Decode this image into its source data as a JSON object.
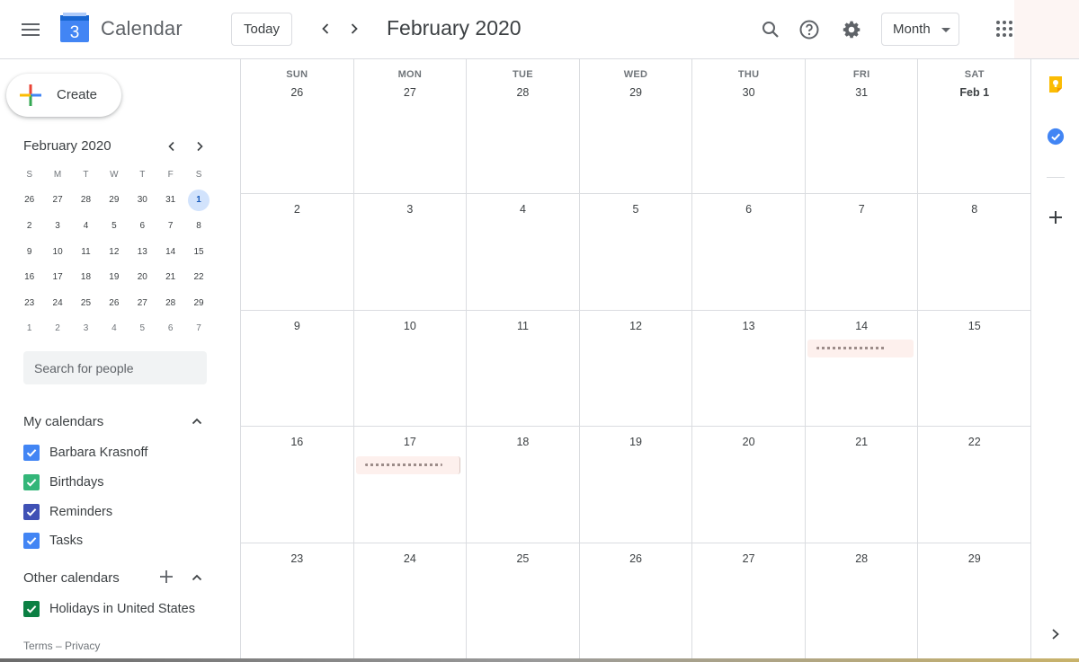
{
  "header": {
    "app_title": "Calendar",
    "logo_day": "3",
    "today_label": "Today",
    "current_period": "February 2020",
    "view_mode": "Month"
  },
  "sidebar": {
    "create_label": "Create",
    "mini_calendar": {
      "title": "February 2020",
      "weekday_initials": [
        "S",
        "M",
        "T",
        "W",
        "T",
        "F",
        "S"
      ],
      "weeks": [
        [
          "26",
          "27",
          "28",
          "29",
          "30",
          "31",
          "1"
        ],
        [
          "2",
          "3",
          "4",
          "5",
          "6",
          "7",
          "8"
        ],
        [
          "9",
          "10",
          "11",
          "12",
          "13",
          "14",
          "15"
        ],
        [
          "16",
          "17",
          "18",
          "19",
          "20",
          "21",
          "22"
        ],
        [
          "23",
          "24",
          "25",
          "26",
          "27",
          "28",
          "29"
        ],
        [
          "1",
          "2",
          "3",
          "4",
          "5",
          "6",
          "7"
        ]
      ],
      "selected_day": "1"
    },
    "search_placeholder": "Search for people",
    "my_calendars": {
      "title": "My calendars",
      "items": [
        {
          "label": "Barbara Krasnoff",
          "color": "#4285f4"
        },
        {
          "label": "Birthdays",
          "color": "#33b679"
        },
        {
          "label": "Reminders",
          "color": "#3f51b5"
        },
        {
          "label": "Tasks",
          "color": "#4285f4"
        }
      ]
    },
    "other_calendars": {
      "title": "Other calendars",
      "items": [
        {
          "label": "Holidays in United States",
          "color": "#0b8043"
        }
      ]
    },
    "footer": {
      "terms": "Terms",
      "separator": "–",
      "privacy": "Privacy"
    }
  },
  "month_grid": {
    "weekday_headers": [
      "SUN",
      "MON",
      "TUE",
      "WED",
      "THU",
      "FRI",
      "SAT"
    ],
    "weeks": [
      [
        "26",
        "27",
        "28",
        "29",
        "30",
        "31",
        "Feb 1"
      ],
      [
        "2",
        "3",
        "4",
        "5",
        "6",
        "7",
        "8"
      ],
      [
        "9",
        "10",
        "11",
        "12",
        "13",
        "14",
        "15"
      ],
      [
        "16",
        "17",
        "18",
        "19",
        "20",
        "21",
        "22"
      ],
      [
        "23",
        "24",
        "25",
        "26",
        "27",
        "28",
        "29"
      ]
    ]
  },
  "side_panel": {
    "icons": [
      "keep-icon",
      "tasks-icon",
      "add-icon"
    ]
  },
  "colors": {
    "accent": "#1a73e8",
    "selected_day_bg": "#d2e3fc",
    "grid_border": "#dadce0"
  }
}
